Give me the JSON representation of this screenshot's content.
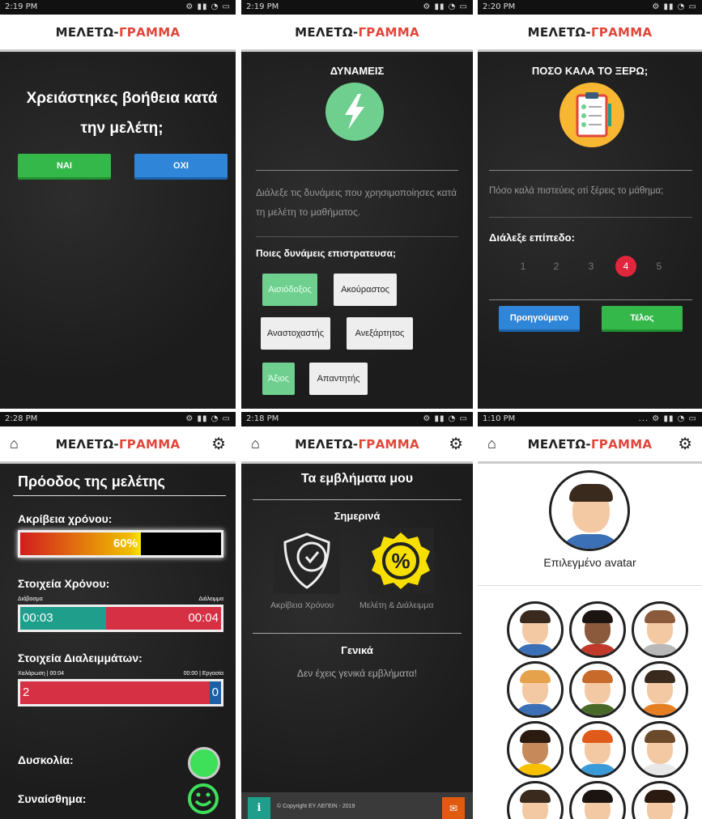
{
  "brand": {
    "part1": "ΜΕΛΕΤΩ-",
    "part2": "ΓΡΑΜΜΑ"
  },
  "icons": {
    "home": "home-icon",
    "settings": "gear-icon",
    "lightning": "lightning-icon",
    "clipboard": "clipboard-icon",
    "shield": "shield-clock-icon",
    "percent": "percent-badge-icon",
    "smiley": "smiley-icon",
    "info": "info-icon",
    "mail": "mail-icon"
  },
  "s1": {
    "time": "2:19 PM",
    "question": "Χρειάστηκες βοήθεια κατά την μελέτη;",
    "yes": "ΝΑΙ",
    "no": "ΟΧΙ"
  },
  "s2": {
    "time": "2:19 PM",
    "title": "ΔΥΝΑΜΕΙΣ",
    "desc": "Διάλεξε τις δυνάμεις που χρησιμοποίησες κατά τη μελέτη το μαθήματος.",
    "subtitle": "Ποιες δυνάμεις επιστρατευσα;",
    "chips": [
      {
        "label": "Αισιόδοξος",
        "selected": true
      },
      {
        "label": "Ακούραστος",
        "selected": false
      },
      {
        "label": "Αναστοχαστής",
        "selected": false
      },
      {
        "label": "Ανεξάρτητος",
        "selected": false
      },
      {
        "label": "Άξιος",
        "selected": true
      },
      {
        "label": "Απαντητής",
        "selected": false
      }
    ]
  },
  "s3": {
    "time": "2:20 PM",
    "title": "ΠΟΣΟ ΚΑΛΑ ΤΟ ΞΕΡΩ;",
    "desc": "Πόσο καλά πιστεύεις οτί ξέρεις το μάθημα;",
    "choose": "Διάλεξε επίπεδο:",
    "levels": [
      "1",
      "2",
      "3",
      "4",
      "5"
    ],
    "selected_level": 4,
    "prev": "Προηγούμενο",
    "finish": "Τέλος"
  },
  "s4": {
    "time": "2:28 PM",
    "title": "Πρόοδος της μελέτης",
    "accuracy_label": "Ακρίβεια χρόνου:",
    "accuracy_value": "60%",
    "accuracy_fraction": 0.6,
    "time_label": "Στοιχεία Χρόνου:",
    "reading": "Διάβασμα",
    "break": "Διάλειμμα",
    "reading_time": "00:03",
    "break_time": "00:04",
    "breaks_label": "Στοιχεία Διαλειμμάτων:",
    "relax": "Χαλάρωση | 00:04",
    "work": "00:00 | Εργασία",
    "relax_count": "2",
    "work_count": "0",
    "difficulty": "Δυσκολία:",
    "feeling": "Συναίσθημα:"
  },
  "s5": {
    "time": "2:18 PM",
    "title": "Τα εμβλήματα μου",
    "today": "Σημερινά",
    "badge1": "Ακρίβεια Χρόνου",
    "badge2": "Μελέτη & Διάλειμμα",
    "general": "Γενικά",
    "no_general": "Δεν έχεις γενικά εμβλήματα!",
    "footer": "© Copyright ΕΥ ΛΕΓΕΙΝ - 2019"
  },
  "s6": {
    "time": "1:10 PM",
    "selected_label": "Επιλεγμένο avatar"
  },
  "colors": {
    "green": "#34b84a",
    "blue": "#2f86d8",
    "red": "#d63044",
    "teal": "#1f9e8c",
    "mint": "#6ecf8f"
  }
}
